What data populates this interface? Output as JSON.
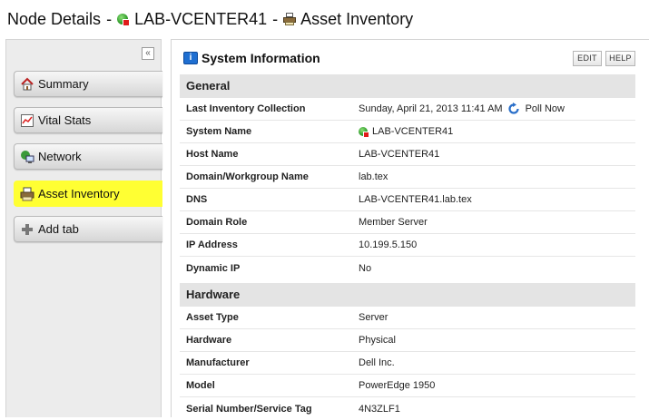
{
  "header": {
    "title_prefix": "Node Details",
    "separator": "-",
    "node_name": "LAB-VCENTER41",
    "page_name": "Asset Inventory"
  },
  "sidebar": {
    "collapse_glyph": "«",
    "tabs": [
      {
        "label": "Summary",
        "icon": "house-icon"
      },
      {
        "label": "Vital Stats",
        "icon": "chart-icon"
      },
      {
        "label": "Network",
        "icon": "network-icon"
      },
      {
        "label": "Asset Inventory",
        "icon": "printer-icon",
        "active": true
      },
      {
        "label": "Add tab",
        "icon": "plus-icon"
      }
    ],
    "active_color": "#ffff33"
  },
  "panel": {
    "title": "System Information",
    "edit_label": "EDIT",
    "help_label": "HELP",
    "sections": [
      {
        "title": "General",
        "rows": [
          {
            "key": "Last Inventory Collection",
            "value": "Sunday, April 21, 2013 11:41 AM",
            "action": "Poll Now"
          },
          {
            "key": "System Name",
            "value": "LAB-VCENTER41"
          },
          {
            "key": "Host Name",
            "value": "LAB-VCENTER41"
          },
          {
            "key": "Domain/Workgroup Name",
            "value": "lab.tex"
          },
          {
            "key": "DNS",
            "value": "LAB-VCENTER41.lab.tex"
          },
          {
            "key": "Domain Role",
            "value": "Member Server"
          },
          {
            "key": "IP Address",
            "value": "10.199.5.150"
          },
          {
            "key": "Dynamic IP",
            "value": "No"
          }
        ]
      },
      {
        "title": "Hardware",
        "rows": [
          {
            "key": "Asset Type",
            "value": "Server"
          },
          {
            "key": "Hardware",
            "value": "Physical"
          },
          {
            "key": "Manufacturer",
            "value": "Dell Inc."
          },
          {
            "key": "Model",
            "value": "PowerEdge 1950"
          },
          {
            "key": "Serial Number/Service Tag",
            "value": "4N3ZLF1"
          }
        ]
      }
    ]
  }
}
